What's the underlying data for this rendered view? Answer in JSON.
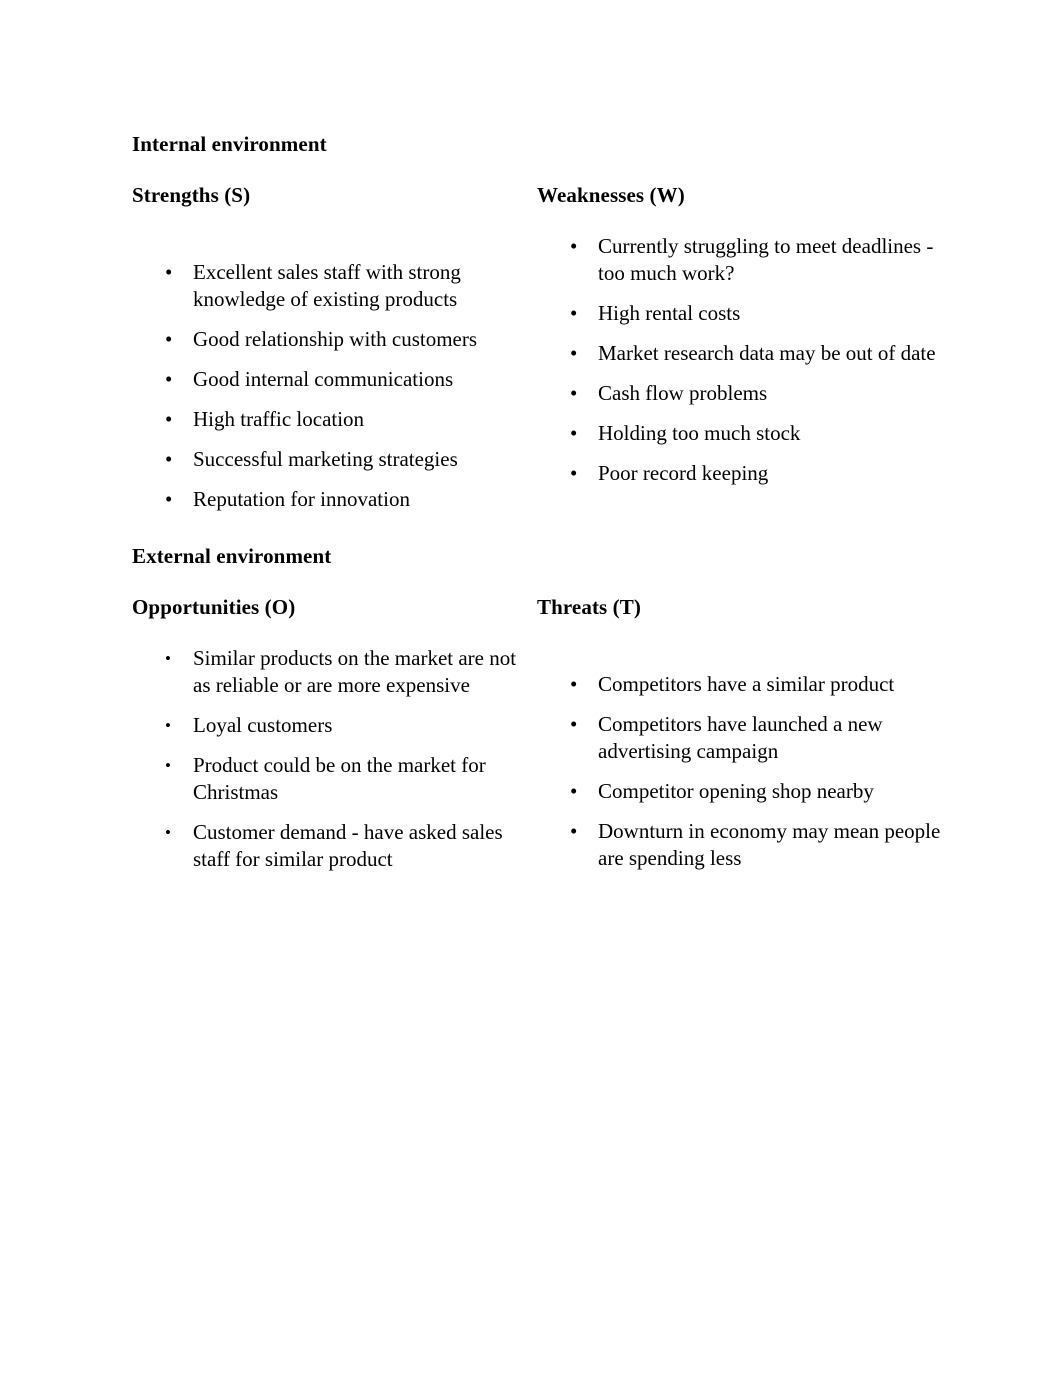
{
  "document": {
    "sections": [
      {
        "id": "internal",
        "heading": "Internal environment",
        "quadrants": [
          {
            "id": "strengths",
            "heading": "Strengths (S)",
            "column": "left",
            "items": [
              "Excellent sales staff with strong knowledge of existing products",
              "Good relationship with customers",
              "Good internal communications",
              "High traffic location",
              "Successful marketing strategies",
              "Reputation for innovation"
            ]
          },
          {
            "id": "weaknesses",
            "heading": "Weaknesses (W)",
            "column": "right",
            "items": [
              "Currently struggling to meet deadlines - too much work?",
              "High rental costs",
              "Market research data may be out of date",
              "Cash flow problems",
              "Holding too much stock",
              "Poor record keeping"
            ]
          }
        ]
      },
      {
        "id": "external",
        "heading": "External environment",
        "quadrants": [
          {
            "id": "opportunities",
            "heading": "Opportunities (O)",
            "column": "left",
            "items": [
              "Similar products on the market are not as reliable or are more expensive",
              "Loyal customers",
              "Product could be on the market for Christmas",
              "Customer demand - have asked sales staff for similar product"
            ]
          },
          {
            "id": "threats",
            "heading": "Threats (T)",
            "column": "right",
            "items": [
              "Competitors have a similar product",
              "Competitors have launched a new advertising campaign",
              "Competitor opening shop nearby",
              "Downturn in economy may mean people are spending less"
            ]
          }
        ]
      }
    ],
    "bullet_glyph": "•",
    "colors": {
      "page_background": "#ffffff",
      "text": "#000000"
    }
  }
}
